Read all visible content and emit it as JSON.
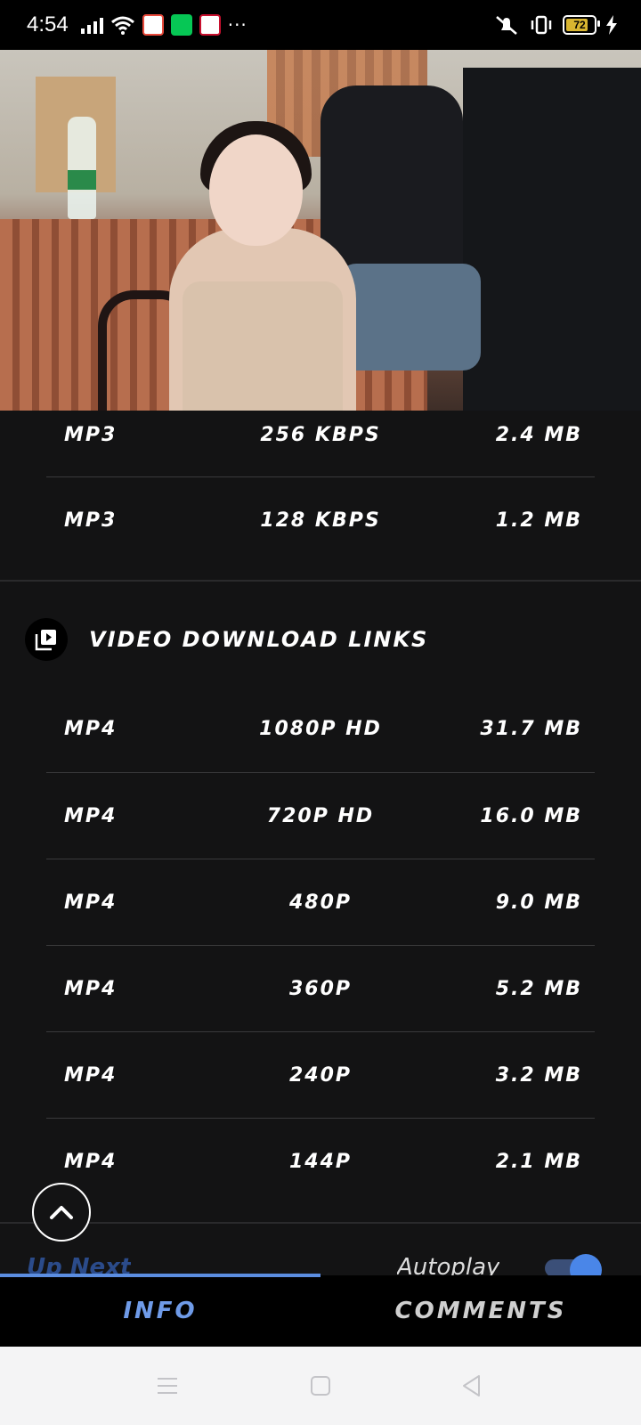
{
  "status_bar": {
    "time": "4:54",
    "battery": "72",
    "more_icons": "···"
  },
  "audio_rows": [
    {
      "format": "MP3",
      "quality": "256 KBPS",
      "size": "2.4 MB"
    },
    {
      "format": "MP3",
      "quality": "128 KBPS",
      "size": "1.2 MB"
    }
  ],
  "video_section": {
    "title": "VIDEO DOWNLOAD LINKS",
    "rows": [
      {
        "format": "MP4",
        "quality": "1080P HD",
        "size": "31.7 MB"
      },
      {
        "format": "MP4",
        "quality": "720P HD",
        "size": "16.0 MB"
      },
      {
        "format": "MP4",
        "quality": "480P",
        "size": "9.0 MB"
      },
      {
        "format": "MP4",
        "quality": "360P",
        "size": "5.2 MB"
      },
      {
        "format": "MP4",
        "quality": "240P",
        "size": "3.2 MB"
      },
      {
        "format": "MP4",
        "quality": "144P",
        "size": "2.1 MB"
      }
    ]
  },
  "up_next": {
    "label": "Up Next",
    "autoplay_label": "Autoplay",
    "autoplay_on": true
  },
  "tabs": [
    {
      "label": "INFO",
      "active": true
    },
    {
      "label": "COMMENTS",
      "active": false
    }
  ],
  "colors": {
    "background": "#131314",
    "accent": "#5b8de0",
    "tab_active": "#6f9be8"
  }
}
